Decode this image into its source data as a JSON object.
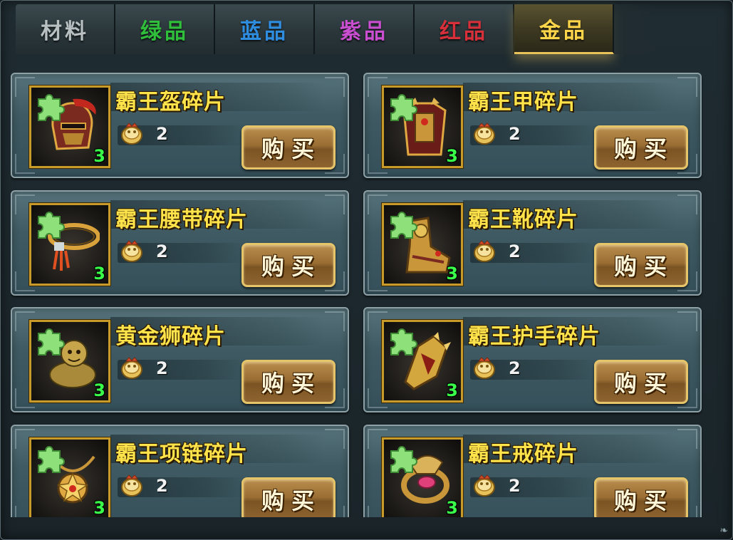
{
  "tabs": [
    {
      "label": "材料",
      "color": "#b8c0c2",
      "active": false
    },
    {
      "label": "绿品",
      "color": "#2fbf3a",
      "active": false
    },
    {
      "label": "蓝品",
      "color": "#2f8de0",
      "active": false
    },
    {
      "label": "紫品",
      "color": "#c94fd0",
      "active": false
    },
    {
      "label": "红品",
      "color": "#d8303a",
      "active": false
    },
    {
      "label": "金品",
      "color": "#ffd54a",
      "active": true
    }
  ],
  "items": [
    {
      "name": "霸王盔碎片",
      "price": "2",
      "count": "3",
      "buy_label": "购买",
      "icon": "helmet-icon"
    },
    {
      "name": "霸王甲碎片",
      "price": "2",
      "count": "3",
      "buy_label": "购买",
      "icon": "armor-icon"
    },
    {
      "name": "霸王腰带碎片",
      "price": "2",
      "count": "3",
      "buy_label": "购买",
      "icon": "belt-icon"
    },
    {
      "name": "霸王靴碎片",
      "price": "2",
      "count": "3",
      "buy_label": "购买",
      "icon": "boots-icon"
    },
    {
      "name": "黄金狮碎片",
      "price": "2",
      "count": "3",
      "buy_label": "购买",
      "icon": "golden-lion-icon"
    },
    {
      "name": "霸王护手碎片",
      "price": "2",
      "count": "3",
      "buy_label": "购买",
      "icon": "gauntlet-icon"
    },
    {
      "name": "霸王项链碎片",
      "price": "2",
      "count": "3",
      "buy_label": "购买",
      "icon": "necklace-icon"
    },
    {
      "name": "霸王戒碎片",
      "price": "2",
      "count": "3",
      "buy_label": "购买",
      "icon": "ring-icon"
    }
  ],
  "currency_icon": "coin-icon",
  "fragment_badge_icon": "puzzle-piece-icon",
  "accent_gold": "#e8c25a",
  "count_color": "#39ff4a",
  "item_name_color": "#ffe34a"
}
